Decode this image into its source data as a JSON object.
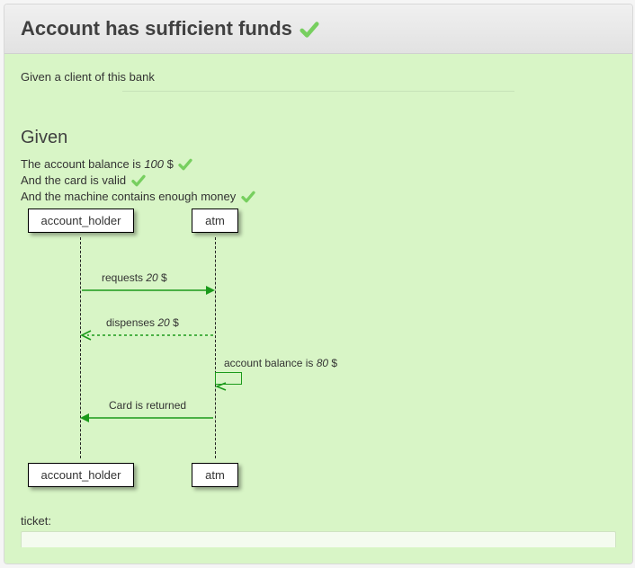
{
  "title": "Account has sufficient funds",
  "background": {
    "given": "Given a client of this bank"
  },
  "scenario": {
    "given_heading": "Given",
    "steps": [
      {
        "prefix": "The account balance is ",
        "value": "100",
        "suffix": " $",
        "passed": true
      },
      {
        "prefix": "And the card is valid",
        "value": "",
        "suffix": "",
        "passed": true
      },
      {
        "prefix": "And the machine contains enough money",
        "value": "",
        "suffix": "",
        "passed": true
      }
    ]
  },
  "chart_data": {
    "type": "sequence-diagram",
    "participants": [
      "account_holder",
      "atm"
    ],
    "messages": [
      {
        "from": "account_holder",
        "to": "atm",
        "text": "requests ",
        "value": "20",
        "suffix": " $",
        "style": "solid"
      },
      {
        "from": "atm",
        "to": "account_holder",
        "text": "dispenses ",
        "value": "20",
        "suffix": " $",
        "style": "dotted"
      },
      {
        "from": "atm",
        "to": "atm",
        "text": "account balance is ",
        "value": "80",
        "suffix": " $",
        "style": "self"
      },
      {
        "from": "atm",
        "to": "account_holder",
        "text": "Card is returned",
        "value": "",
        "suffix": "",
        "style": "solid"
      }
    ]
  },
  "footer": {
    "ticket_label": "ticket:"
  },
  "theme": {
    "arrow_color": "#1a9a1a"
  }
}
